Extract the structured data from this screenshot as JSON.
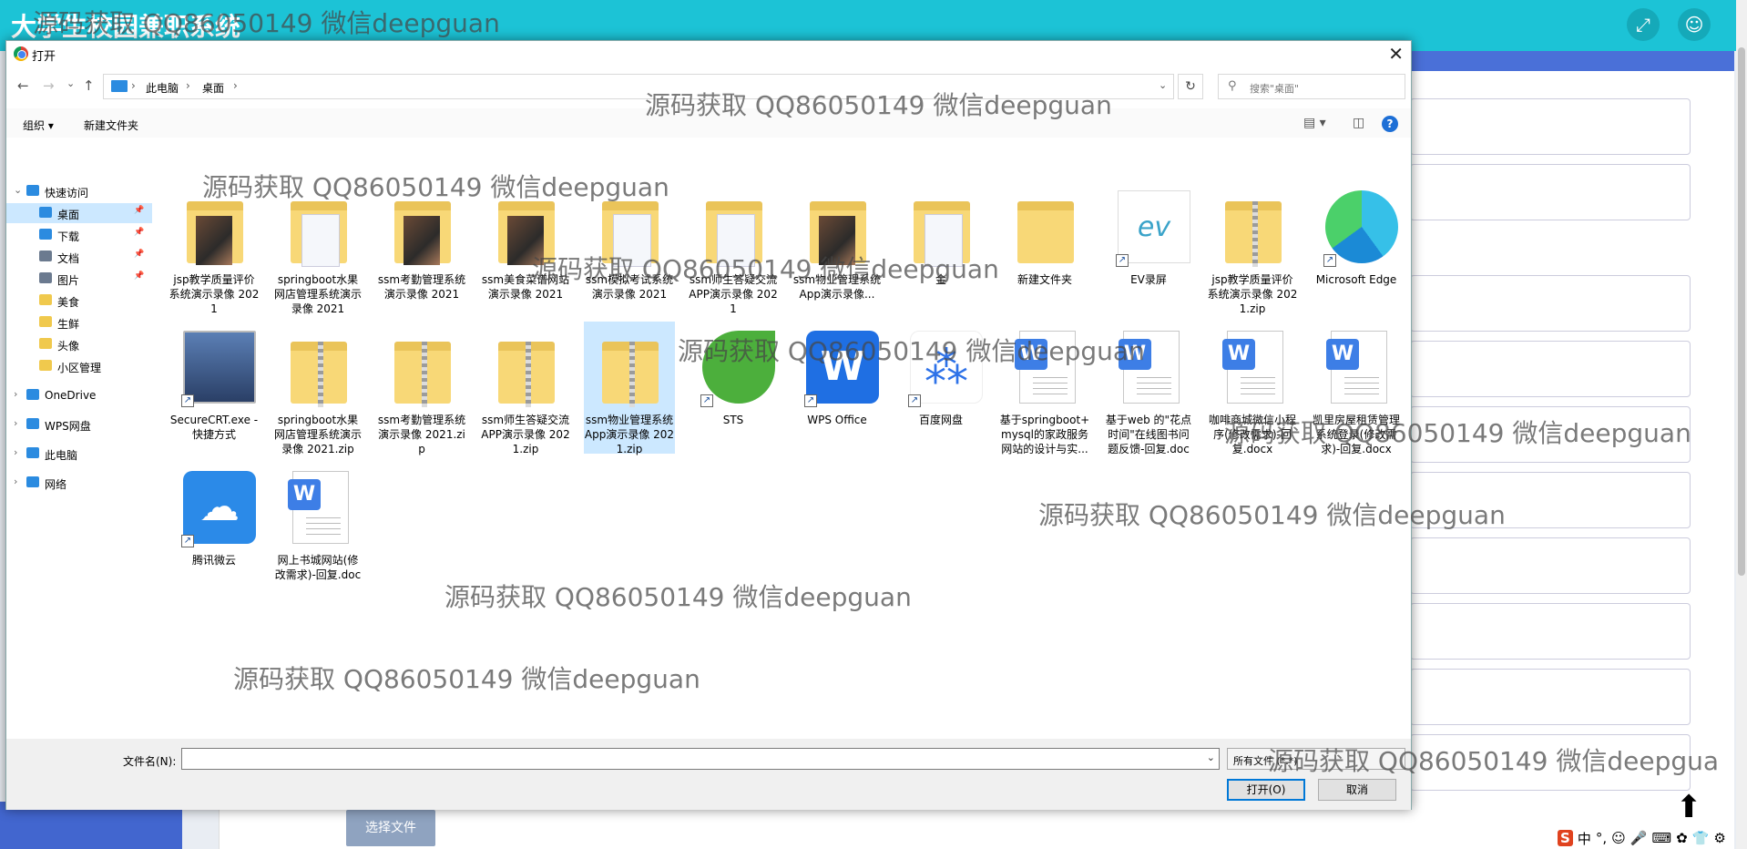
{
  "app": {
    "title": "大学生校园兼职系统",
    "choose_file": "选择文件"
  },
  "dialog": {
    "title": "打开",
    "close": "✕",
    "breadcrumb": [
      "此电脑",
      "桌面"
    ],
    "search_placeholder": "搜索\"桌面\"",
    "toolbar": {
      "organize": "组织 ▾",
      "new_folder": "新建文件夹"
    },
    "nav": [
      {
        "label": "快速访问",
        "icon": "star-icon"
      },
      {
        "label": "桌面",
        "icon": "desktop-icon",
        "selected": true
      },
      {
        "label": "下载",
        "icon": "download-icon"
      },
      {
        "label": "文档",
        "icon": "document-icon"
      },
      {
        "label": "图片",
        "icon": "picture-icon"
      },
      {
        "label": "美食",
        "icon": "folder-icon"
      },
      {
        "label": "生鲜",
        "icon": "folder-icon"
      },
      {
        "label": "头像",
        "icon": "folder-icon"
      },
      {
        "label": "小区管理",
        "icon": "folder-icon"
      },
      {
        "label": "OneDrive",
        "icon": "cloud-icon"
      },
      {
        "label": "WPS网盘",
        "icon": "cloud-icon"
      },
      {
        "label": "此电脑",
        "icon": "computer-icon"
      },
      {
        "label": "网络",
        "icon": "network-icon"
      }
    ],
    "files": [
      {
        "name": "jsp教学质量评价系统演示录像 2021",
        "kind": "folder-photo"
      },
      {
        "name": "springboot水果网店管理系统演示录像 2021",
        "kind": "folder-doc"
      },
      {
        "name": "ssm考勤管理系统演示录像 2021",
        "kind": "folder-photo"
      },
      {
        "name": "ssm美食菜谱网站演示录像 2021",
        "kind": "folder-photo"
      },
      {
        "name": "ssm模拟考试系统演示录像 2021",
        "kind": "folder-doc"
      },
      {
        "name": "ssm师生答疑交流APP演示录像 2021",
        "kind": "folder-doc"
      },
      {
        "name": "ssm物业管理系统App演示录像...",
        "kind": "folder-photo"
      },
      {
        "name": "金",
        "kind": "folder-doc"
      },
      {
        "name": "新建文件夹",
        "kind": "folder"
      },
      {
        "name": "EV录屏",
        "kind": "ev"
      },
      {
        "name": "jsp教学质量评价系统演示录像 2021.zip",
        "kind": "zip"
      },
      {
        "name": "Microsoft Edge",
        "kind": "edge"
      },
      {
        "name": "SecureCRT.exe - 快捷方式",
        "kind": "securecrt"
      },
      {
        "name": "springboot水果网店管理系统演示录像 2021.zip",
        "kind": "zip"
      },
      {
        "name": "ssm考勤管理系统演示录像 2021.zip",
        "kind": "zip"
      },
      {
        "name": "ssm师生答疑交流APP演示录像 2021.zip",
        "kind": "zip"
      },
      {
        "name": "ssm物业管理系统App演示录像 2021.zip",
        "kind": "zip",
        "selected": true
      },
      {
        "name": "STS",
        "kind": "sts"
      },
      {
        "name": "WPS Office",
        "kind": "wps"
      },
      {
        "name": "百度网盘",
        "kind": "baidu"
      },
      {
        "name": "基于springboot+mysql的家政服务网站的设计与实...",
        "kind": "word"
      },
      {
        "name": "基于web 的\"花点时间\"在线图书问题反馈-回复.doc",
        "kind": "word"
      },
      {
        "name": "咖啡商城微信小程序(修改需求)-回复.docx",
        "kind": "word"
      },
      {
        "name": "凯里房屋租赁管理系统登录(修改需求)-回复.docx",
        "kind": "word"
      },
      {
        "name": "腾讯微云",
        "kind": "weiyun"
      },
      {
        "name": "网上书城网站(修改需求)-回复.doc",
        "kind": "word"
      }
    ],
    "filename_label": "文件名(N):",
    "filename_value": "",
    "filetype": "所有文件 (*.*)",
    "open_button": "打开(O)",
    "cancel_button": "取消"
  },
  "watermark": "源码获取 QQ86050149 微信deepguan",
  "tray": [
    "S",
    "中",
    "°,",
    "☺",
    "🎤",
    "⌨",
    "✿",
    "👕",
    "⚙"
  ]
}
